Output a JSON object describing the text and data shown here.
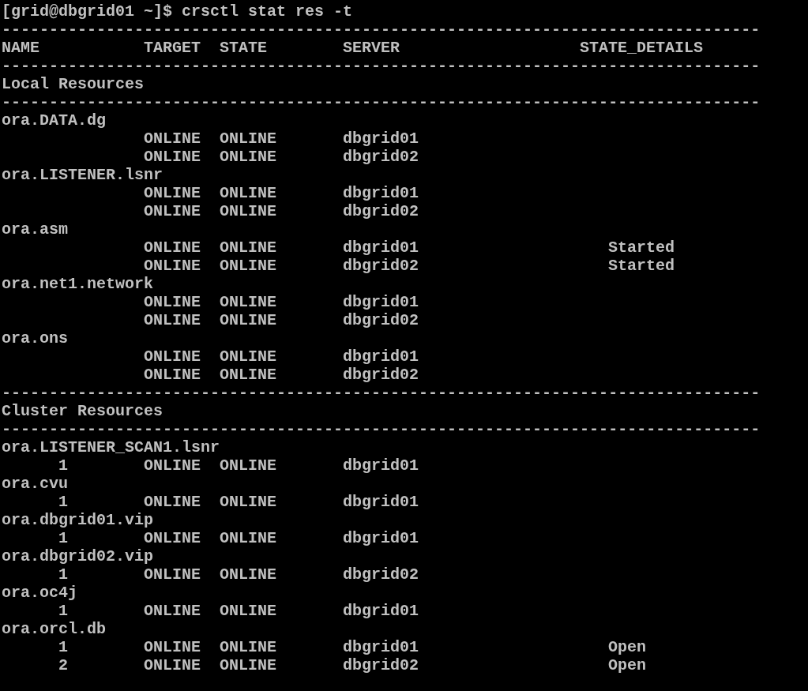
{
  "prompt": "[grid@dbgrid01 ~]$ crsctl stat res -t",
  "lines": [
    {
      "kind": "rule",
      "text": "--------------------------------------------------------------------------------"
    },
    {
      "kind": "header",
      "columns": [
        "NAME",
        "TARGET",
        "STATE",
        "SERVER",
        "STATE_DETAILS"
      ]
    },
    {
      "kind": "rule",
      "text": "--------------------------------------------------------------------------------"
    },
    {
      "kind": "section",
      "text": "Local Resources"
    },
    {
      "kind": "rule",
      "text": "--------------------------------------------------------------------------------"
    },
    {
      "kind": "resource",
      "text": "ora.DATA.dg"
    },
    {
      "kind": "row",
      "target": "ONLINE",
      "state": "ONLINE",
      "server": "dbgrid01"
    },
    {
      "kind": "row",
      "target": "ONLINE",
      "state": "ONLINE",
      "server": "dbgrid02"
    },
    {
      "kind": "resource",
      "text": "ora.LISTENER.lsnr"
    },
    {
      "kind": "row",
      "target": "ONLINE",
      "state": "ONLINE",
      "server": "dbgrid01"
    },
    {
      "kind": "row",
      "target": "ONLINE",
      "state": "ONLINE",
      "server": "dbgrid02"
    },
    {
      "kind": "resource",
      "text": "ora.asm"
    },
    {
      "kind": "row",
      "target": "ONLINE",
      "state": "ONLINE",
      "server": "dbgrid01",
      "state_details": "Started"
    },
    {
      "kind": "row",
      "target": "ONLINE",
      "state": "ONLINE",
      "server": "dbgrid02",
      "state_details": "Started"
    },
    {
      "kind": "resource",
      "text": "ora.net1.network"
    },
    {
      "kind": "row",
      "target": "ONLINE",
      "state": "ONLINE",
      "server": "dbgrid01"
    },
    {
      "kind": "row",
      "target": "ONLINE",
      "state": "ONLINE",
      "server": "dbgrid02"
    },
    {
      "kind": "resource",
      "text": "ora.ons"
    },
    {
      "kind": "row",
      "target": "ONLINE",
      "state": "ONLINE",
      "server": "dbgrid01"
    },
    {
      "kind": "row",
      "target": "ONLINE",
      "state": "ONLINE",
      "server": "dbgrid02"
    },
    {
      "kind": "rule",
      "text": "--------------------------------------------------------------------------------"
    },
    {
      "kind": "section",
      "text": "Cluster Resources"
    },
    {
      "kind": "rule",
      "text": "--------------------------------------------------------------------------------"
    },
    {
      "kind": "resource",
      "text": "ora.LISTENER_SCAN1.lsnr"
    },
    {
      "kind": "row",
      "instance": "1",
      "target": "ONLINE",
      "state": "ONLINE",
      "server": "dbgrid01"
    },
    {
      "kind": "resource",
      "text": "ora.cvu"
    },
    {
      "kind": "row",
      "instance": "1",
      "target": "ONLINE",
      "state": "ONLINE",
      "server": "dbgrid01"
    },
    {
      "kind": "resource",
      "text": "ora.dbgrid01.vip"
    },
    {
      "kind": "row",
      "instance": "1",
      "target": "ONLINE",
      "state": "ONLINE",
      "server": "dbgrid01"
    },
    {
      "kind": "resource",
      "text": "ora.dbgrid02.vip"
    },
    {
      "kind": "row",
      "instance": "1",
      "target": "ONLINE",
      "state": "ONLINE",
      "server": "dbgrid02"
    },
    {
      "kind": "resource",
      "text": "ora.oc4j"
    },
    {
      "kind": "row",
      "instance": "1",
      "target": "ONLINE",
      "state": "ONLINE",
      "server": "dbgrid01"
    },
    {
      "kind": "resource",
      "text": "ora.orcl.db"
    },
    {
      "kind": "row",
      "instance": "1",
      "target": "ONLINE",
      "state": "ONLINE",
      "server": "dbgrid01",
      "state_details": "Open"
    },
    {
      "kind": "row",
      "instance": "2",
      "target": "ONLINE",
      "state": "ONLINE",
      "server": "dbgrid02",
      "state_details": "Open"
    }
  ]
}
